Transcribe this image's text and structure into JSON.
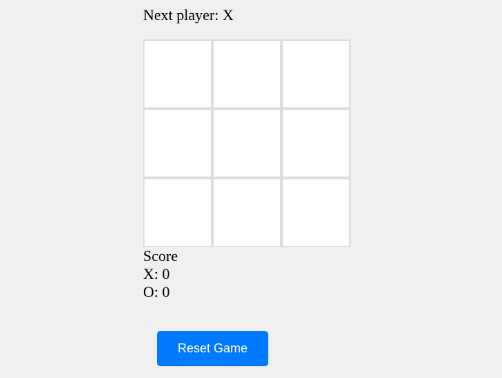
{
  "status": "Next player: X",
  "board": [
    "",
    "",
    "",
    "",
    "",
    "",
    "",
    "",
    ""
  ],
  "score": {
    "title": "Score",
    "x_line": "X: 0",
    "o_line": "O: 0"
  },
  "reset_label": "Reset Game",
  "colors": {
    "button": "#007bff",
    "cell_border": "#dddddd",
    "background": "#f0f0f0"
  }
}
